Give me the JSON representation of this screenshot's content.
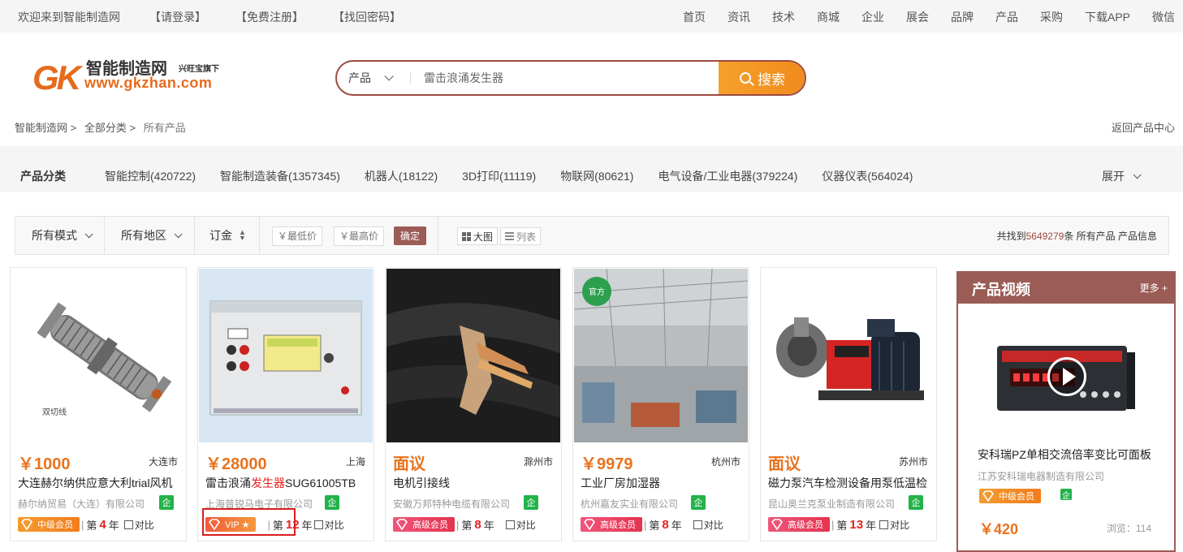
{
  "topbar": {
    "welcome": "欢迎来到智能制造网",
    "login": "【请登录】",
    "register": "【免费注册】",
    "forgot": "【找回密码】",
    "nav": [
      "首页",
      "资讯",
      "技术",
      "商城",
      "企业",
      "展会",
      "品牌",
      "产品",
      "采购",
      "下载APP",
      "微信"
    ]
  },
  "logo": {
    "mark": "GK",
    "name": "智能制造网",
    "sub": "兴旺宝旗下",
    "url": "www.gkzhan.com"
  },
  "search": {
    "category": "产品",
    "placeholder": "雷击浪涌发生器",
    "button": "搜索"
  },
  "breadcrumb": {
    "home": "智能制造网 >",
    "all": "全部分类 >",
    "current": "所有产品",
    "back": "返回产品中心"
  },
  "categories": {
    "title": "产品分类",
    "items": [
      "智能控制(420722)",
      "智能制造装备(1357345)",
      "机器人(18122)",
      "3D打印(11119)",
      "物联网(80621)",
      "电气设备/工业电器(379224)",
      "仪器仪表(564024)"
    ],
    "more": "展开"
  },
  "filter": {
    "mode": "所有模式",
    "region": "所有地区",
    "deposit": "订金",
    "min_placeholder": "￥最低价",
    "max_placeholder": "￥最高价",
    "dash": "-",
    "confirm": "确定",
    "view_big": "大图",
    "view_list": "列表",
    "count_prefix": "共找到",
    "count": "5649279",
    "count_suffix": "条 所有产品 产品信息"
  },
  "products": [
    {
      "price": "￥1000",
      "city": "大连市",
      "title": "大连赫尔纳供应意大利trial风机",
      "title_hl": "",
      "title_tail": "",
      "company": "赫尔纳贸易（大连）有限公司",
      "qi": "企",
      "badge": "中级会员",
      "rank_pre": "第",
      "years": "4",
      "rank_post": "年",
      "compare": "对比"
    },
    {
      "price": "￥28000",
      "city": "上海",
      "title": "雷击浪涌",
      "title_hl": "发生器",
      "title_tail": "SUG61005TB",
      "company": "上海普锐马电子有限公司",
      "qi": "企",
      "badge": "VIP ★",
      "rank_pre": "第",
      "years": "12",
      "rank_post": "年",
      "compare": "对比"
    },
    {
      "price": "面议",
      "city": "滁州市",
      "title": "电机引接线",
      "title_hl": "",
      "title_tail": "",
      "company": "安徽万邦特种电缆有限公司",
      "qi": "企",
      "badge": "高级会员",
      "rank_pre": "第",
      "years": "8",
      "rank_post": "年",
      "compare": "对比"
    },
    {
      "price": "￥9979",
      "city": "杭州市",
      "title": "工业厂房加湿器",
      "title_hl": "",
      "title_tail": "",
      "company": "杭州嘉友实业有限公司",
      "qi": "企",
      "badge": "高级会员",
      "rank_pre": "第",
      "years": "8",
      "rank_post": "年",
      "compare": "对比"
    },
    {
      "price": "面议",
      "city": "苏州市",
      "title": "磁力泵汽车检测设备用泵低温检",
      "title_hl": "",
      "title_tail": "",
      "company": "昆山奥兰克泵业制造有限公司",
      "qi": "企",
      "badge": "高级会员",
      "rank_pre": "第",
      "years": "13",
      "rank_post": "年",
      "compare": "对比"
    }
  ],
  "product_images": {
    "p1_label": "双切线",
    "p4_badge": "官方"
  },
  "video": {
    "title": "产品视频",
    "more": "更多 +",
    "product": "安科瑞PZ单相交流倍率变比可面板",
    "company": "江苏安科瑞电器制造有限公司",
    "badge": "中级会员",
    "qi": "企",
    "price": "￥420",
    "views": "浏览：114"
  },
  "colors": {
    "brand": "#9b5c55",
    "price": "#e8731e",
    "accent": "#f08a1c"
  }
}
